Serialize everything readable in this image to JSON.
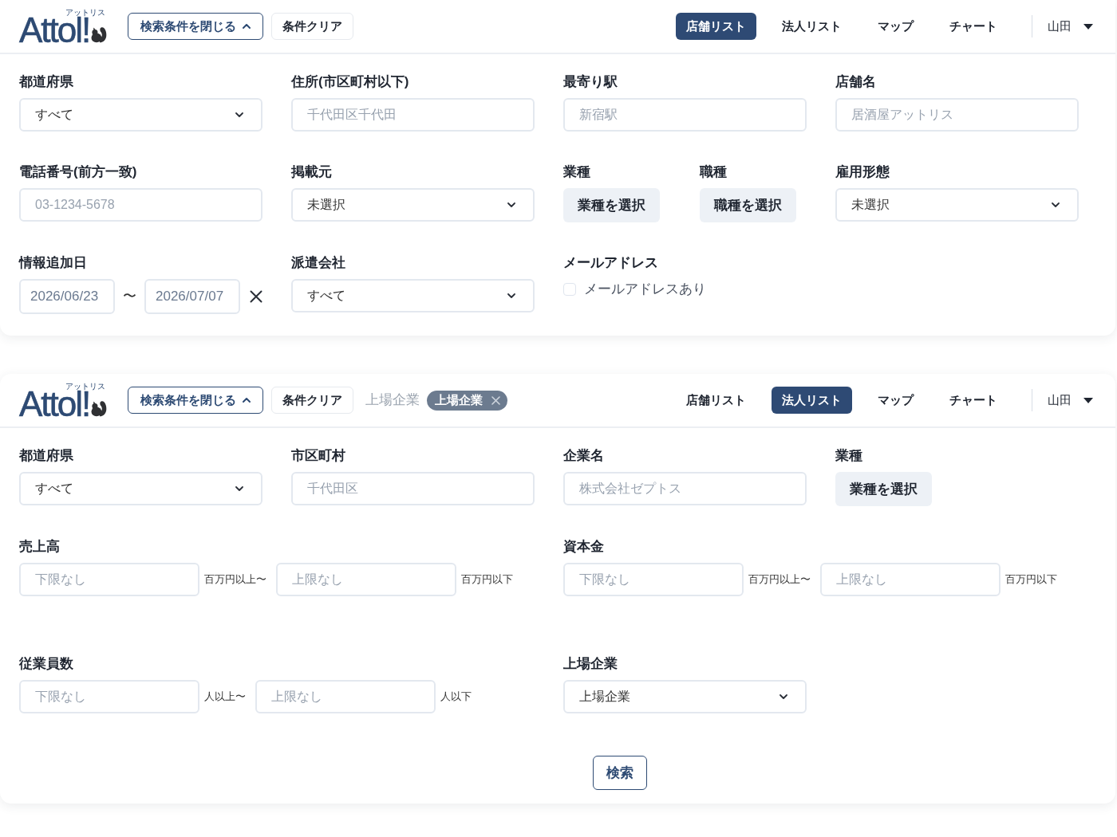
{
  "panels": [
    {
      "header": {
        "logo": {
          "ruby": "アットリス",
          "text": "Attol!"
        },
        "toggle_button": "検索条件を閉じる",
        "clear_button": "条件クリア",
        "nav": [
          {
            "label": "店舗リスト",
            "selected": true
          },
          {
            "label": "法人リスト",
            "selected": false
          },
          {
            "label": "マップ",
            "selected": false
          },
          {
            "label": "チャート",
            "selected": false
          }
        ],
        "user": "山田"
      },
      "fields": [
        {
          "kind": "select",
          "label": "都道府県",
          "value": "すべて"
        },
        {
          "kind": "text",
          "label": "住所(市区町村以下)",
          "placeholder": "千代田区千代田"
        },
        {
          "kind": "text",
          "label": "最寄り駅",
          "placeholder": "新宿駅"
        },
        {
          "kind": "text",
          "label": "店舗名",
          "placeholder": "居酒屋アットリス"
        },
        {
          "kind": "text",
          "label": "電話番号(前方一致)",
          "placeholder": "03-1234-5678"
        },
        {
          "kind": "select",
          "label": "掲載元",
          "value": "未選択"
        },
        {
          "kind": "picker_pair",
          "items": [
            {
              "label": "業種",
              "button": "業種を選択"
            },
            {
              "label": "職種",
              "button": "職種を選択"
            }
          ]
        },
        {
          "kind": "select",
          "label": "雇用形態",
          "value": "未選択"
        },
        {
          "kind": "date_range",
          "label": "情報追加日",
          "from": "2026/06/23",
          "separator": "〜",
          "to": "2026/07/07"
        },
        {
          "kind": "select",
          "label": "派遣会社",
          "value": "すべて"
        },
        {
          "kind": "checkbox",
          "label": "メールアドレス",
          "option": "メールアドレスあり",
          "checked": false
        }
      ]
    },
    {
      "header": {
        "logo": {
          "ruby": "アットリス",
          "text": "Attol!"
        },
        "toggle_button": "検索条件を閉じる",
        "clear_button": "条件クリア",
        "filter_summary": "上場企業",
        "filter_tags": [
          {
            "label": "上場企業"
          }
        ],
        "nav": [
          {
            "label": "店舗リスト",
            "selected": false
          },
          {
            "label": "法人リスト",
            "selected": true
          },
          {
            "label": "マップ",
            "selected": false
          },
          {
            "label": "チャート",
            "selected": false
          }
        ],
        "user": "山田"
      },
      "fields": [
        {
          "kind": "select",
          "label": "都道府県",
          "value": "すべて"
        },
        {
          "kind": "text",
          "label": "市区町村",
          "placeholder": "千代田区"
        },
        {
          "kind": "text",
          "label": "企業名",
          "placeholder": "株式会社ゼプトス"
        },
        {
          "kind": "picker",
          "label": "業種",
          "button": "業種を選択"
        },
        {
          "kind": "range",
          "label": "売上高",
          "min_placeholder": "下限なし",
          "min_unit": "百万円以上〜",
          "max_placeholder": "上限なし",
          "max_unit": "百万円以下"
        },
        {
          "kind": "range",
          "label": "資本金",
          "min_placeholder": "下限なし",
          "min_unit": "百万円以上〜",
          "max_placeholder": "上限なし",
          "max_unit": "百万円以下"
        },
        {
          "kind": "range",
          "label": "従業員数",
          "min_placeholder": "下限なし",
          "min_unit": "人以上〜",
          "max_placeholder": "上限なし",
          "max_unit": "人以下"
        },
        {
          "kind": "select",
          "label": "上場企業",
          "value": "上場企業"
        }
      ],
      "search_button": "検索"
    }
  ]
}
